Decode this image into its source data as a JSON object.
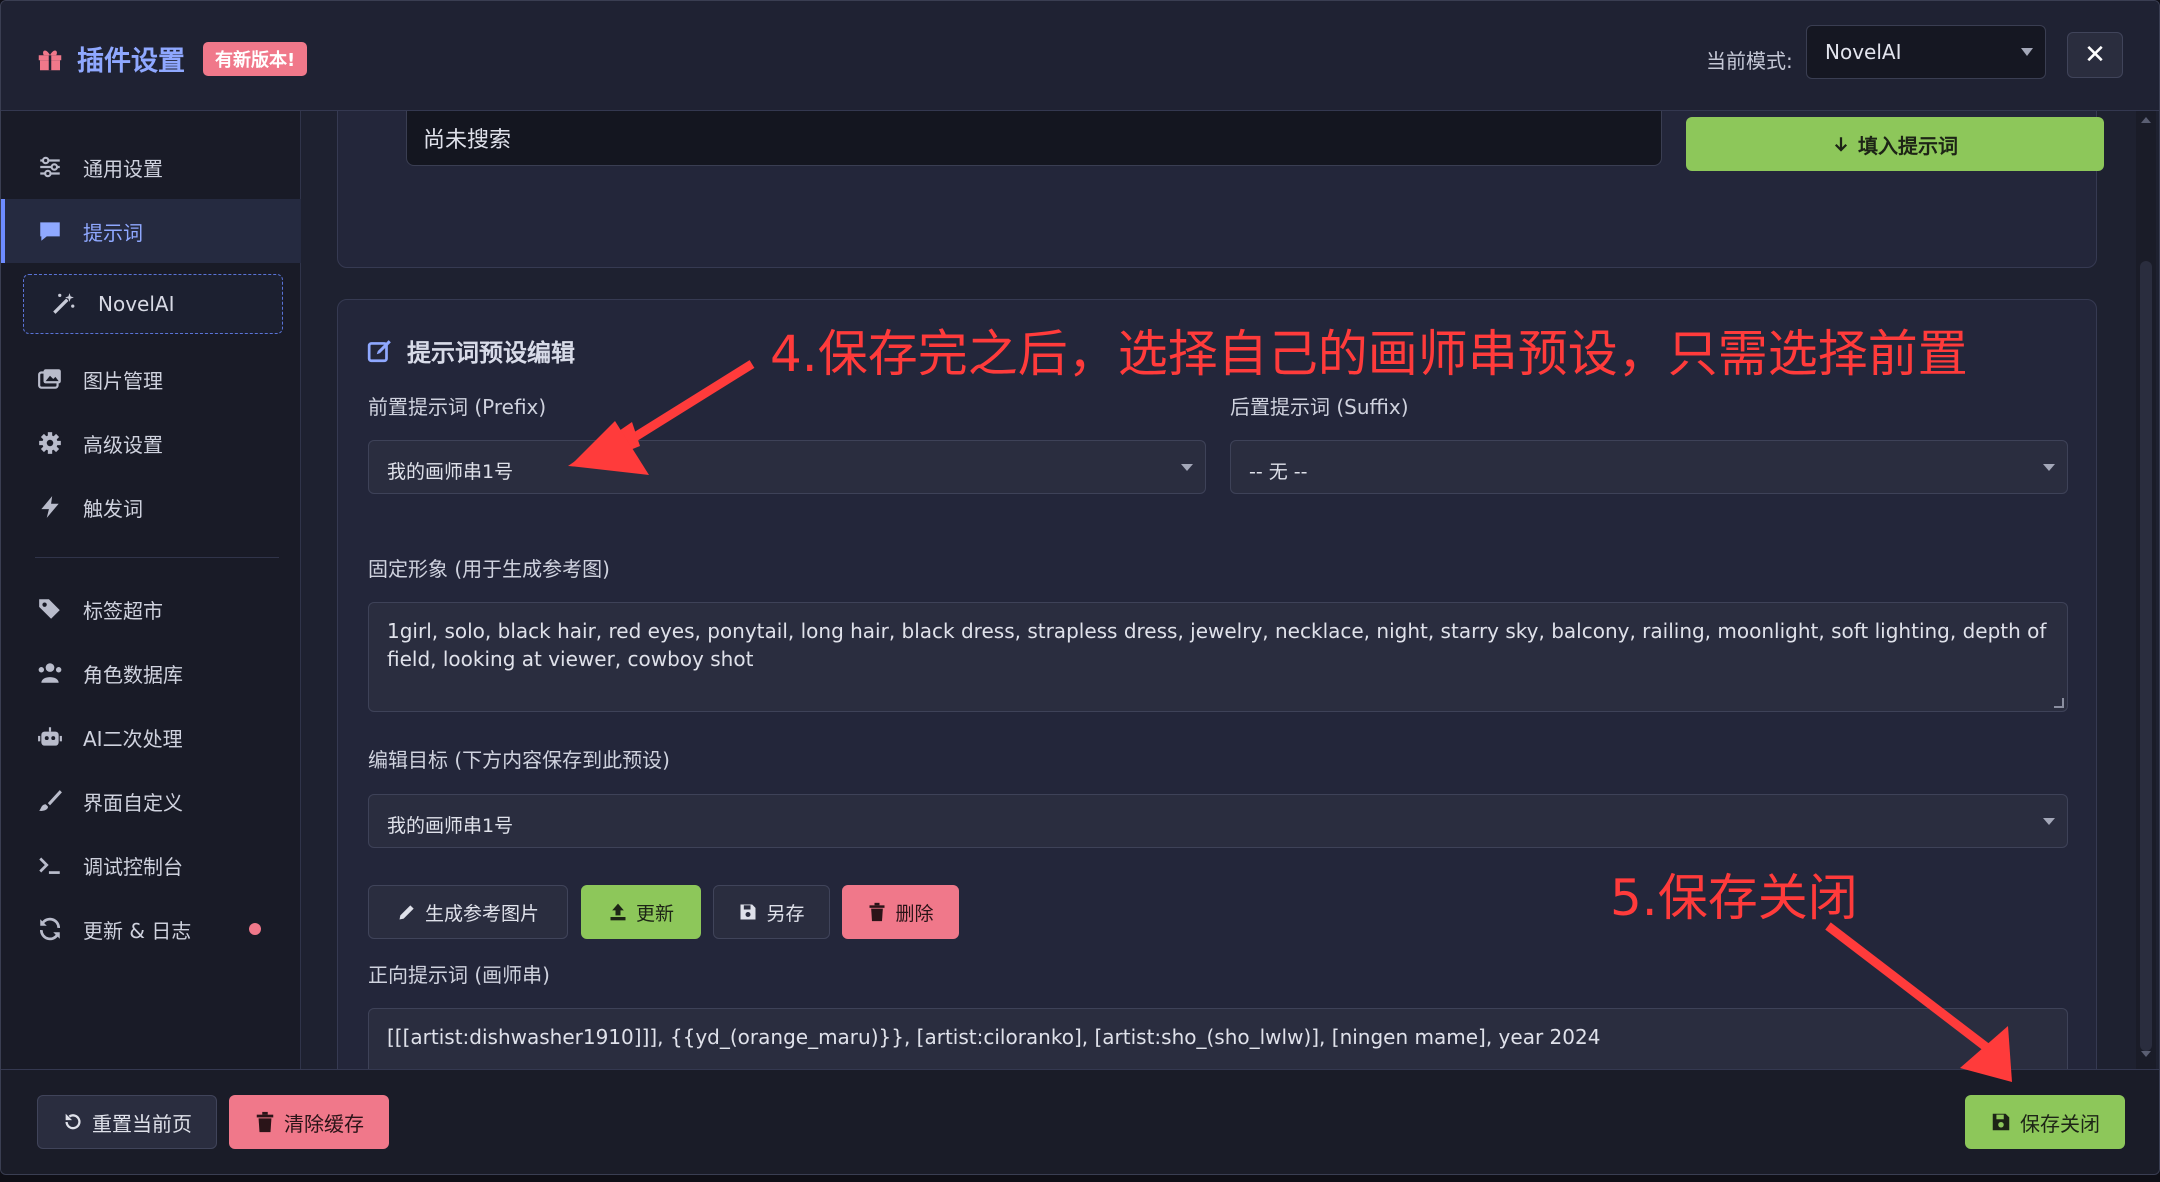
{
  "header": {
    "title": "插件设置",
    "badge": "有新版本!",
    "mode_label": "当前模式:",
    "mode_value": "NovelAI",
    "close_symbol": "✕",
    "brand_icon": "gift-icon"
  },
  "sidebar": {
    "items": [
      {
        "label": "通用设置",
        "icon": "sliders-icon"
      },
      {
        "label": "提示词",
        "icon": "comment-icon"
      },
      {
        "label": "NovelAI",
        "icon": "magic-wand-icon"
      },
      {
        "label": "图片管理",
        "icon": "images-icon"
      },
      {
        "label": "高级设置",
        "icon": "gear-icon"
      },
      {
        "label": "触发词",
        "icon": "bolt-icon"
      },
      {
        "label": "标签超市",
        "icon": "tags-icon"
      },
      {
        "label": "角色数据库",
        "icon": "users-icon"
      },
      {
        "label": "AI二次处理",
        "icon": "robot-icon"
      },
      {
        "label": "界面自定义",
        "icon": "brush-icon"
      },
      {
        "label": "调试控制台",
        "icon": "terminal-icon"
      },
      {
        "label": "更新 & 日志",
        "icon": "sync-icon"
      }
    ]
  },
  "search": {
    "status_text": "尚未搜索",
    "fill_button": "填入提示词"
  },
  "editor": {
    "title": "提示词预设编辑",
    "prefix_label": "前置提示词 (Prefix)",
    "prefix_value": "我的画师串1号",
    "suffix_label": "后置提示词 (Suffix)",
    "suffix_value": "-- 无 --",
    "fixed_label": "固定形象 (用于生成参考图)",
    "fixed_value": "1girl, solo, black hair, red eyes, ponytail, long hair, black dress, strapless dress, jewelry, necklace, night, starry sky, balcony, railing, moonlight, soft lighting, depth of field, looking at viewer, cowboy shot",
    "target_label": "编辑目标 (下方内容保存到此预设)",
    "target_value": "我的画师串1号",
    "buttons": {
      "generate": "生成参考图片",
      "update": "更新",
      "save_as": "另存",
      "delete": "删除"
    },
    "positive_label": "正向提示词 (画师串)",
    "positive_value": "[[[artist:dishwasher1910]]], {{yd_(orange_maru)}}, [artist:ciloranko], [artist:sho_(sho_lwlw)], [ningen mame], year 2024"
  },
  "footer": {
    "reset": "重置当前页",
    "clear_cache": "清除缓存",
    "save_close": "保存关闭"
  },
  "annotations": {
    "step4": "4.保存完之后，选择自己的画师串预设，只需选择前置",
    "step5": "5.保存关闭",
    "color": "#ff3b3b"
  },
  "colors": {
    "accent": "#8fa8ff",
    "green": "#8dc75a",
    "pink": "#f0788a",
    "background": "#1e2130"
  }
}
